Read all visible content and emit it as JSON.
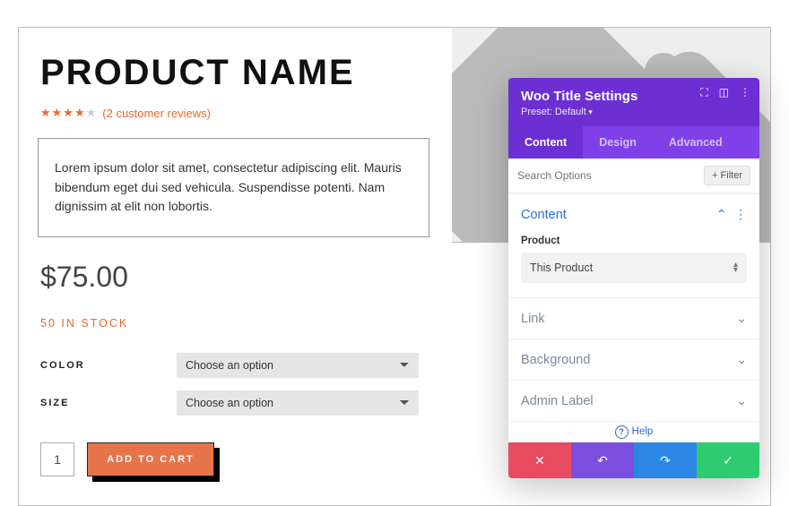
{
  "product": {
    "title": "PRODUCT NAME",
    "review_count_text": "(2 customer reviews)",
    "description": "Lorem ipsum dolor sit amet, consectetur adipiscing elit. Mauris bibendum eget dui sed vehicula. Suspendisse potenti. Nam dignissim at elit non lobortis.",
    "price": "$75.00",
    "stock_text": "50 IN STOCK",
    "variations": {
      "color_label": "COLOR",
      "color_placeholder": "Choose an option",
      "size_label": "SIZE",
      "size_placeholder": "Choose an option"
    },
    "qty_value": "1",
    "add_to_cart_label": "ADD TO CART"
  },
  "panel": {
    "title": "Woo Title Settings",
    "preset_label": "Preset: Default",
    "tabs": {
      "content": "Content",
      "design": "Design",
      "advanced": "Advanced"
    },
    "search_placeholder": "Search Options",
    "filter_label": "+  Filter",
    "sections": {
      "content": {
        "title": "Content",
        "product_label": "Product",
        "product_value": "This Product"
      },
      "link": "Link",
      "background": "Background",
      "admin_label": "Admin Label"
    },
    "help_label": "Help"
  }
}
